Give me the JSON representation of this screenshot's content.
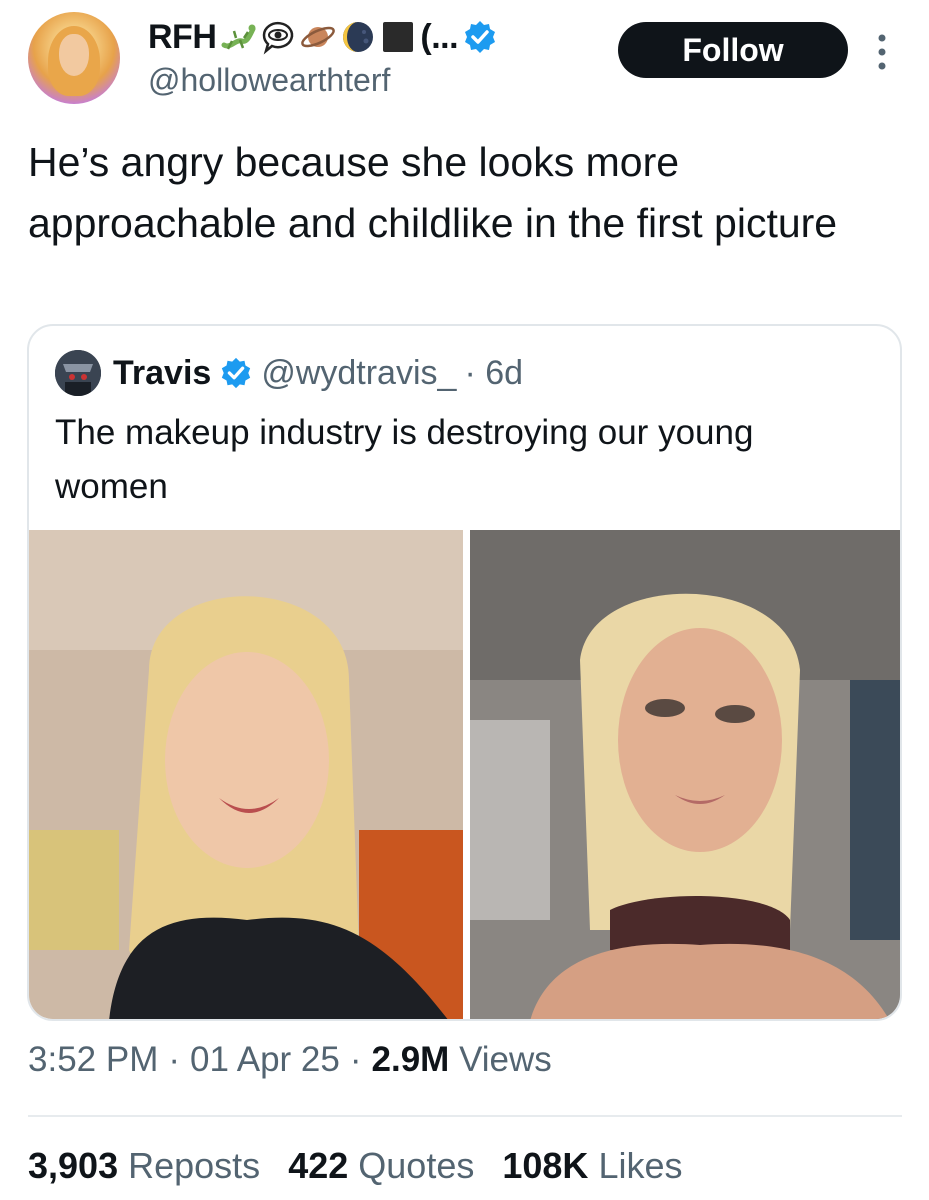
{
  "author": {
    "name": "RFH",
    "name_suffix": "(...",
    "handle": "@hollowearthterf",
    "verified_color": "#1d9bf0",
    "emoji_icons": [
      "lizard-icon",
      "eye-speech-bubble-icon",
      "ringed-planet-icon",
      "crescent-moon-icon",
      "black-square-icon"
    ]
  },
  "follow_label": "Follow",
  "tweet_text": "He’s angry because she looks more approachable and childlike in the first picture",
  "quote": {
    "name": "Travis",
    "handle": "@wydtravis_",
    "age": "· 6d",
    "text": "The makeup industry is destroying our young women"
  },
  "meta": {
    "time": "3:52 PM",
    "dot1": "·",
    "date": "01 Apr 25",
    "dot2": "·",
    "views_count": "2.9M",
    "views_label": "Views"
  },
  "stats": [
    {
      "count": "3,903",
      "label": "Reposts"
    },
    {
      "count": "422",
      "label": "Quotes"
    },
    {
      "count": "108K",
      "label": "Likes"
    }
  ]
}
